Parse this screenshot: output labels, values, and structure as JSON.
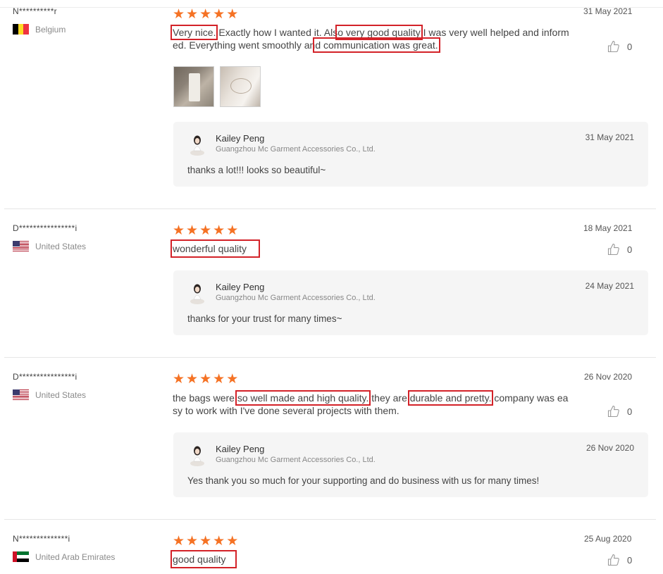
{
  "reviews": [
    {
      "buyer": "N**********r",
      "country": "Belgium",
      "flag": "belgium-flag",
      "rating": 5,
      "date": "31 May 2021",
      "comment": {
        "p1": "Very nice.",
        "p2": " Exactly how I wanted it. Als",
        "p3": "o very good quality",
        "p4": " I was very well helped and informed. Everything went smoothly an",
        "p5": "d communication was great."
      },
      "likes": "0",
      "reply": {
        "seller": "Kailey Peng",
        "company": "Guangzhou Mc Garment Accessories Co., Ltd.",
        "date": "31 May 2021",
        "text": "thanks a lot!!! looks  so beautiful~"
      }
    },
    {
      "buyer": "D****************i",
      "country": "United States",
      "flag": "united-states-flag",
      "rating": 5,
      "date": "18 May 2021",
      "comment": {
        "p1": "wonderful quality"
      },
      "likes": "0",
      "reply": {
        "seller": "Kailey Peng",
        "company": "Guangzhou Mc Garment Accessories Co., Ltd.",
        "date": "24 May 2021",
        "text": "thanks for your trust  for many times~"
      }
    },
    {
      "buyer": "D****************i",
      "country": "United States",
      "flag": "united-states-flag",
      "rating": 5,
      "date": "26 Nov 2020",
      "comment": {
        "p1": "the bags were ",
        "p2": "so well made and high quality.",
        "p3": " they are ",
        "p4": "durable and pretty.",
        "p5": " company was easy to work with I've done several projects with them."
      },
      "likes": "0",
      "reply": {
        "seller": "Kailey Peng",
        "company": "Guangzhou Mc Garment Accessories Co., Ltd.",
        "date": "26 Nov 2020",
        "text": "Yes thank you so much for your supporting and do business with us for many times!"
      }
    },
    {
      "buyer": "N**************i",
      "country": "United Arab Emirates",
      "flag": "uae-flag",
      "rating": 5,
      "date": "25 Aug 2020",
      "comment": {
        "p1": "good quality"
      },
      "likes": "0"
    }
  ],
  "colors": {
    "star": "#f57224",
    "highlight": "#d32228",
    "reply_bg": "#f5f5f5"
  }
}
